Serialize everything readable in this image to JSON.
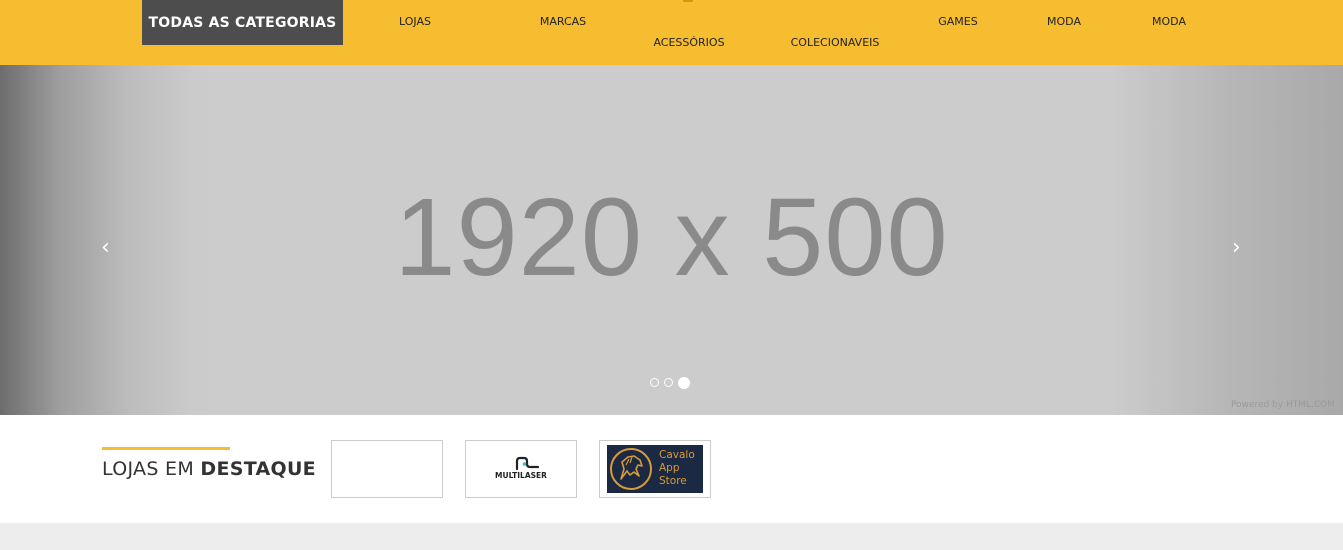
{
  "header": {
    "all_categories_label": "TODAS AS CATEGORIAS",
    "nav": [
      "LOJAS",
      "MARCAS",
      "ACESSÓRIOS",
      "COLECIONAVEIS",
      "GAMES",
      "MODA",
      "MODA"
    ]
  },
  "slider": {
    "slide_text": "1920 x 500",
    "prev_icon": "chevron-left-icon",
    "next_icon": "chevron-right-icon",
    "total_slides": 3,
    "active_slide": 3,
    "powered_by": "Powered by HTML.COM"
  },
  "featured": {
    "title_light": "LOJAS EM ",
    "title_bold": "DESTAQUE",
    "stores": [
      {
        "label": ""
      },
      {
        "label": "MULTILASER"
      },
      {
        "label_lines": [
          "Cavalo",
          "App",
          "Store"
        ]
      }
    ]
  },
  "colors": {
    "accent": "#f5bd2f",
    "category_button": "#4d4d4d",
    "cavalo_bg": "#1b2942",
    "cavalo_gold": "#d89a3a"
  }
}
